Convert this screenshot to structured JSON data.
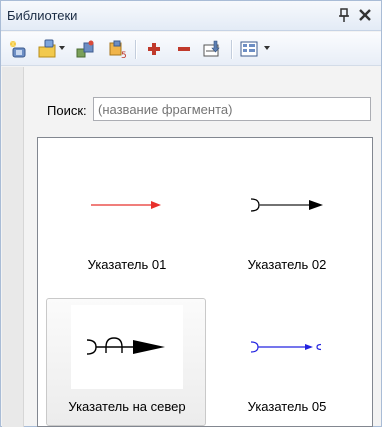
{
  "panel": {
    "title": "Библиотеки",
    "pin_glyph": "ᵠ",
    "close_glyph": "x"
  },
  "toolbar": {
    "buttons": [
      {
        "name": "new-library-icon"
      },
      {
        "name": "open-library-icon"
      },
      {
        "name": "library-manager-icon"
      },
      {
        "name": "library-properties-icon"
      },
      {
        "name": "add-fragment-icon"
      },
      {
        "name": "remove-fragment-icon"
      },
      {
        "name": "insert-fragment-icon"
      },
      {
        "name": "view-mode-icon"
      }
    ]
  },
  "search": {
    "label": "Поиск:",
    "placeholder": "(название фрагмента)"
  },
  "items": [
    {
      "label": "Указатель 01",
      "color": "#e8302c"
    },
    {
      "label": "Указатель 02",
      "color": "#000000"
    },
    {
      "label": "Указатель на север",
      "color": "#000000",
      "selected": true
    },
    {
      "label": "Указатель 05",
      "color": "#2323e0"
    }
  ]
}
